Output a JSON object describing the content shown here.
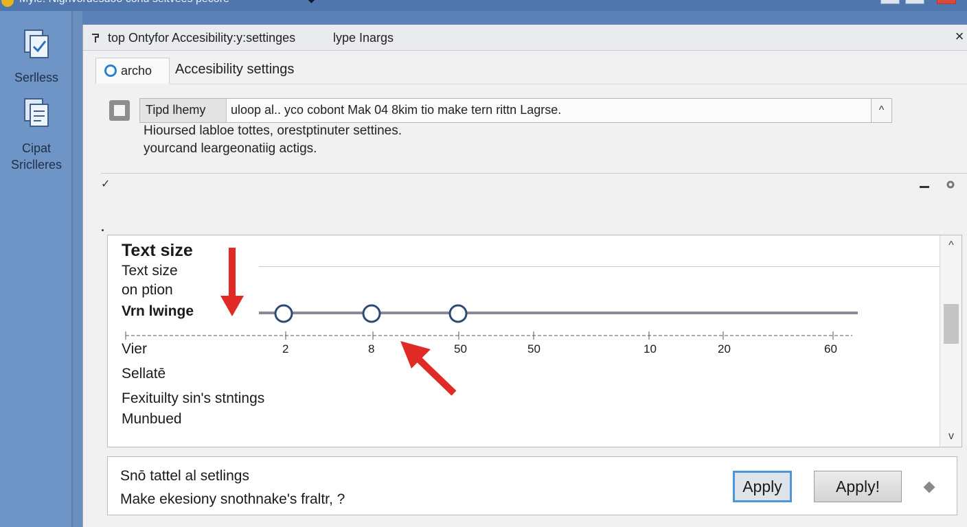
{
  "window": {
    "title": "Myie:   Nigrivoruesdoo conu seitvees pecore"
  },
  "leftnav": {
    "items": [
      {
        "label": "Serlless",
        "icon": "shield-check-icon"
      },
      {
        "label": "Cipat Sriclleres",
        "icon": "document-stack-icon"
      }
    ]
  },
  "dialog": {
    "title": "top Ontyfor Accesibility:y:settinges",
    "subtitle": "lype Inargs",
    "close_label": "×",
    "tab": {
      "radio_label": "archo",
      "section_title": "Accesibility settings"
    },
    "notice": {
      "label": "Tipd lhemy",
      "text": "uloop al.. yco cobont Mak 04 8kim tio make tern rittn Lagrse.",
      "collapse_glyph": "^"
    },
    "description": [
      "Hioursed labloe tottes, orestptinuter settines.",
      "yourcand leargeonatiig actigs."
    ],
    "chevron_glyph": "✓"
  },
  "text_size": {
    "heading": "Text size",
    "lines": [
      "Text size",
      "on ption"
    ],
    "range_label": "Vrn lwinge",
    "view_label": "Vier",
    "tick_labels": [
      "2",
      "8",
      "50",
      "50",
      "10",
      "20",
      "60"
    ],
    "slider_handles": [
      "2",
      "8",
      "50"
    ],
    "options": [
      "Sellatē",
      "Fexituilty sin's stntings",
      "Munbued"
    ],
    "scroll_up": "^",
    "scroll_down": "v"
  },
  "bottom": {
    "title": "Snō tattel al setlings",
    "description": "Make ekesiony snothnake's fraltr, ?",
    "apply_label": "Apply",
    "apply2_label": "Apply!"
  },
  "colors": {
    "arrow_red": "#e02a25",
    "accent_blue": "#2a7fd4",
    "nav_bg": "#6f95c6"
  }
}
